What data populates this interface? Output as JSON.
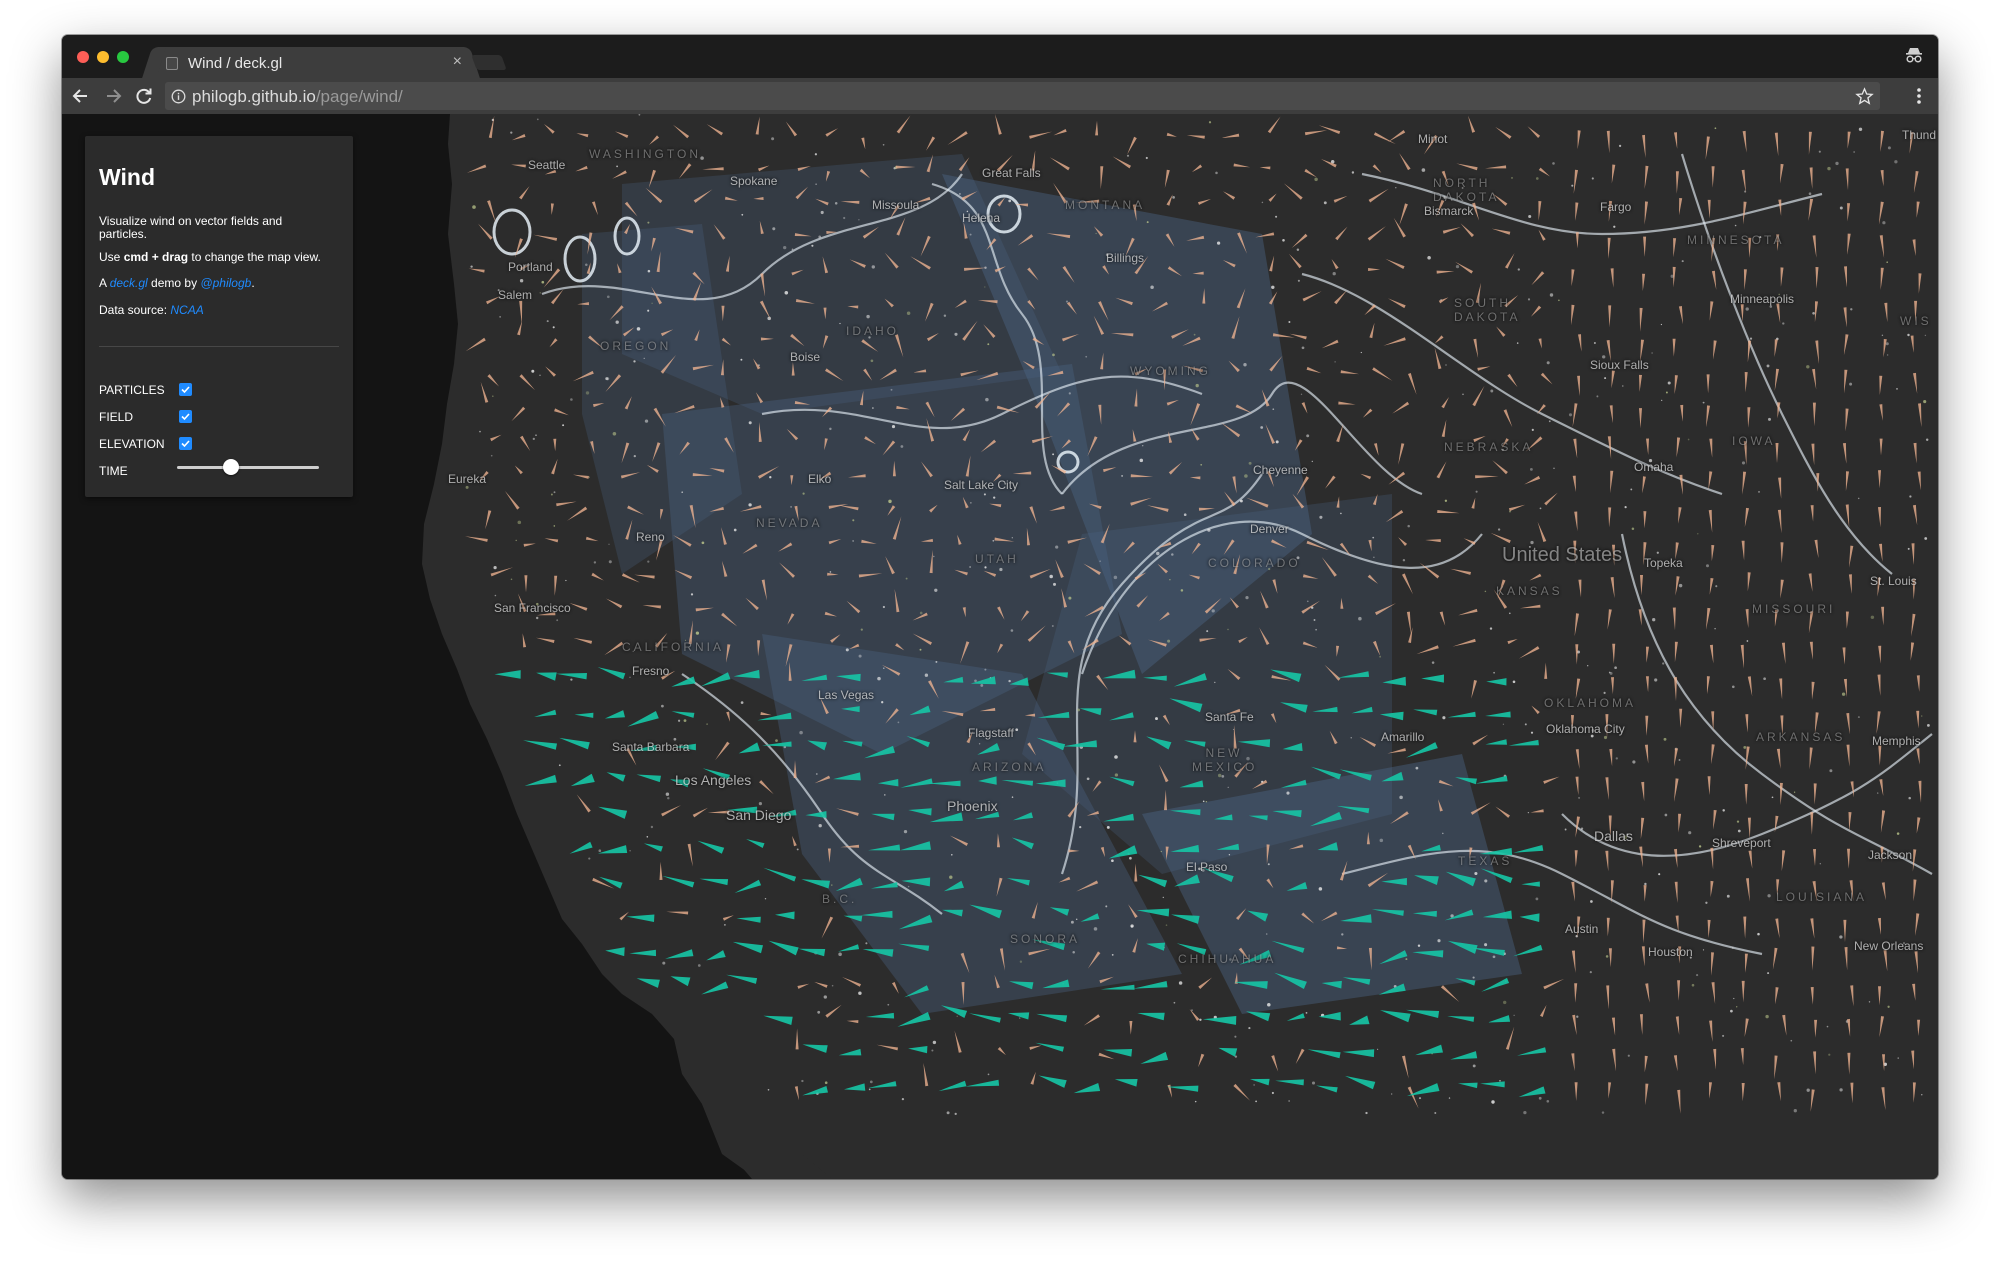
{
  "browser": {
    "tab_title": "Wind / deck.gl",
    "url_host": "philogb.github.io",
    "url_path": "/page/wind/"
  },
  "panel": {
    "title": "Wind",
    "description": "Visualize wind on vector fields and particles.",
    "help_prefix": "Use ",
    "help_bold": "cmd + drag",
    "help_suffix": " to change the map view.",
    "credit_prefix": "A ",
    "credit_link": "deck.gl",
    "credit_middle": " demo by ",
    "credit_author": "@philogb",
    "credit_suffix": ".",
    "source_prefix": "Data source: ",
    "source_link": "NCAA",
    "controls": {
      "particles_label": "PARTICLES",
      "particles_checked": true,
      "field_label": "FIELD",
      "field_checked": true,
      "elevation_label": "ELEVATION",
      "elevation_checked": true,
      "time_label": "TIME",
      "time_value": 0.38
    }
  },
  "map": {
    "colors": {
      "land": "#2c2c2c",
      "ocean": "#141414",
      "elevation": "#4a6585",
      "arrow_warm": "#f0b391",
      "arrow_cool": "#16c7a6",
      "particles": "#e4edf5"
    },
    "labels": {
      "washington": "WASHINGTON",
      "seattle": "Seattle",
      "spokane": "Spokane",
      "great_falls": "Great Falls",
      "minot": "Minot",
      "north_dakota": "NORTH DAKOTA",
      "bismarck": "Bismarck",
      "fargo": "Fargo",
      "missoula": "Missoula",
      "helena": "Helena",
      "montana": "MONTANA",
      "billings": "Billings",
      "minnesota": "MINNESOTA",
      "minneapolis": "Minneapolis",
      "portland": "Portland",
      "salem": "Salem",
      "oregon": "OREGON",
      "idaho": "IDAHO",
      "boise": "Boise",
      "south_dakota": "SOUTH DAKOTA",
      "sioux_falls": "Sioux Falls",
      "wyoming": "WYOMING",
      "eureka": "Eureka",
      "elko": "Elko",
      "salt_lake_city": "Salt Lake City",
      "cheyenne": "Cheyenne",
      "nebraska": "NEBRASKA",
      "omaha": "Omaha",
      "iowa": "IOWA",
      "reno": "Reno",
      "nevada": "NEVADA",
      "utah": "UTAH",
      "colorado": "COLORADO",
      "denver": "Denver",
      "united_states": "United States",
      "topeka": "Topeka",
      "kansas": "KANSAS",
      "st_louis": "St. Louis",
      "missouri": "MISSOURI",
      "san_francisco": "San Francisco",
      "fresno": "Fresno",
      "california": "CALIFORNIA",
      "las_vegas": "Las Vegas",
      "santa_fe": "Santa Fe",
      "oklahoma": "OKLAHOMA",
      "oklahoma_city": "Oklahoma City",
      "flagstaff": "Flagstaff",
      "arizona": "ARIZONA",
      "amarillo": "Amarillo",
      "new_mexico": "NEW MEXICO",
      "arkansas": "ARKANSAS",
      "memphis": "Memphis",
      "santa_barbara": "Santa Barbara",
      "los_angeles": "Los Angeles",
      "san_diego": "San Diego",
      "phoenix": "Phoenix",
      "dallas": "Dallas",
      "shreveport": "Shreveport",
      "jackson": "Jackson",
      "el_paso": "El Paso",
      "texas": "TEXAS",
      "bc": "B.C.",
      "louisiana": "LOUISIANA",
      "sonora": "SONORA",
      "chihuahua": "CHIHUAHUA",
      "austin": "Austin",
      "houston": "Houston",
      "new_orleans": "New Orleans",
      "thunder_bay": "Thund",
      "wisconsin": "WIS"
    }
  }
}
